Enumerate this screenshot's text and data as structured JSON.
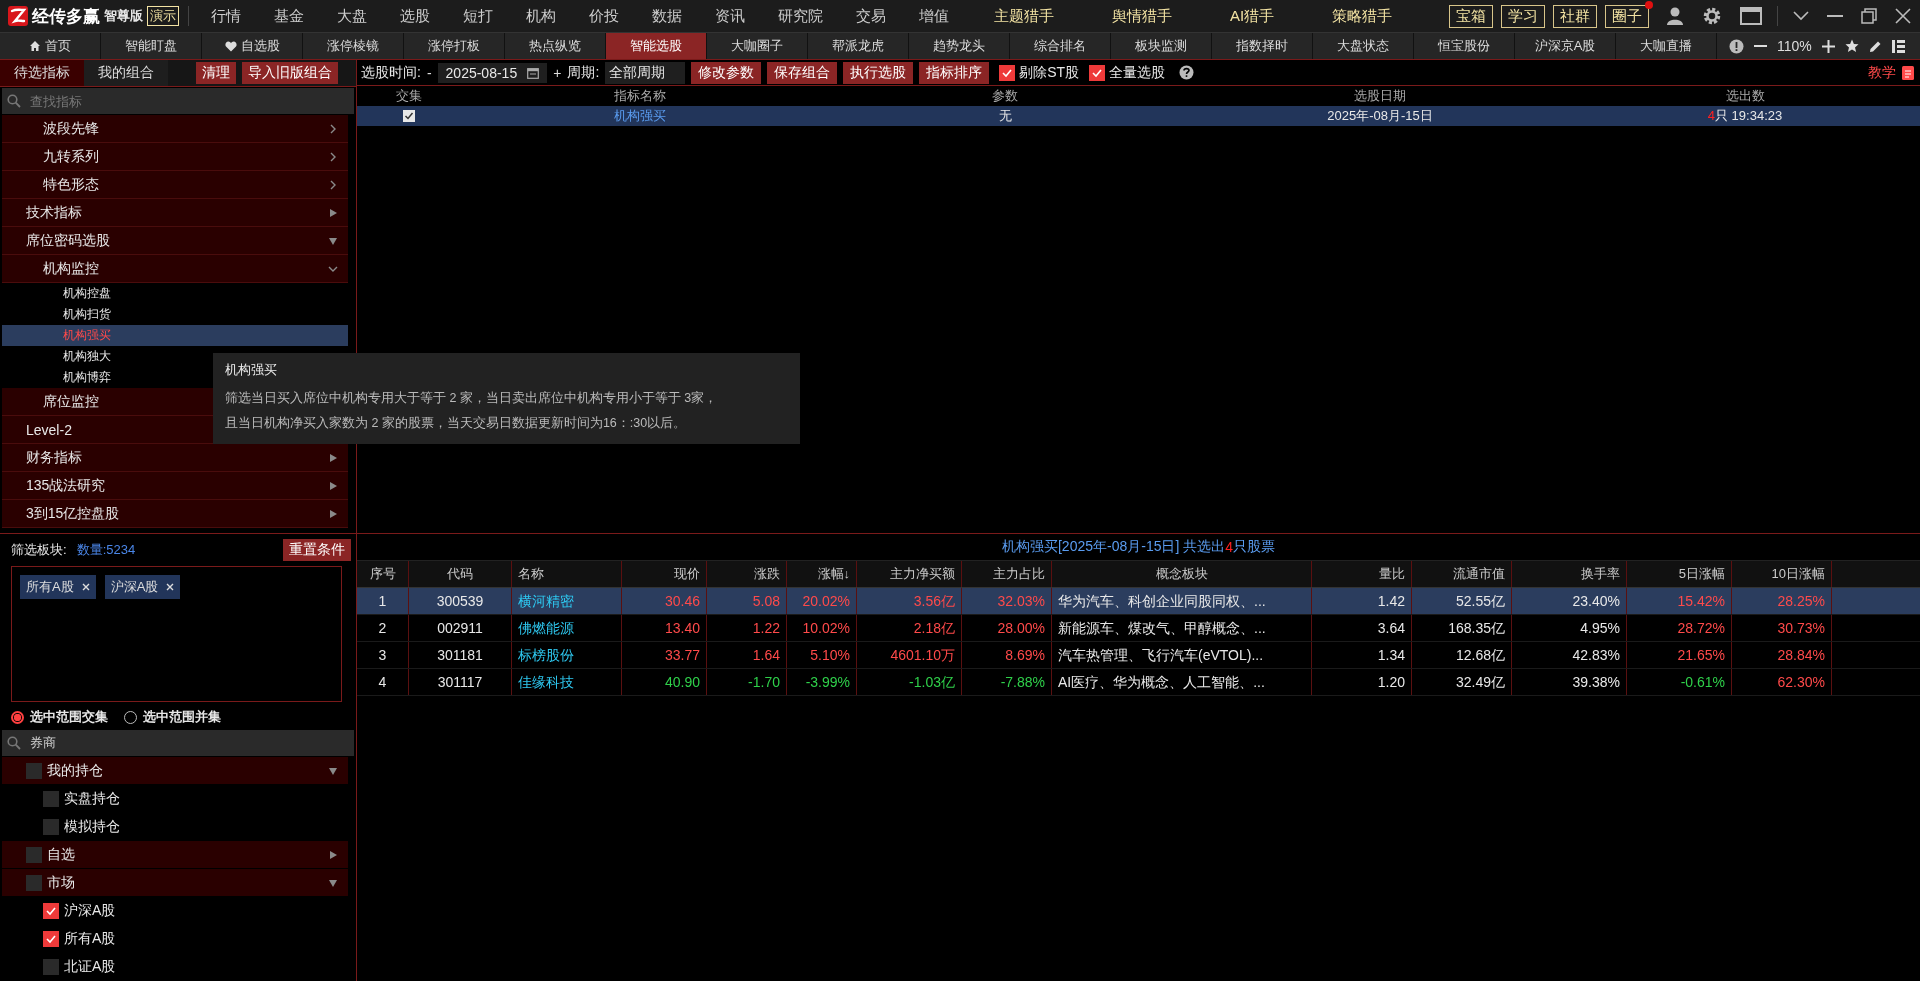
{
  "app": {
    "logo_text": "经传多赢",
    "edition": "智尊版",
    "demo_badge": "演示"
  },
  "main_menu": [
    {
      "label": "行情",
      "highlight": false
    },
    {
      "label": "基金",
      "highlight": false
    },
    {
      "label": "大盘",
      "highlight": false
    },
    {
      "label": "选股",
      "highlight": false
    },
    {
      "label": "短打",
      "highlight": false
    },
    {
      "label": "机构",
      "highlight": false
    },
    {
      "label": "价投",
      "highlight": false
    },
    {
      "label": "数据",
      "highlight": false
    },
    {
      "label": "资讯",
      "highlight": false
    },
    {
      "label": "研究院",
      "highlight": false
    },
    {
      "label": "交易",
      "highlight": false
    },
    {
      "label": "增值",
      "highlight": false
    },
    {
      "label": "主题猎手",
      "highlight": true
    },
    {
      "label": "舆情猎手",
      "highlight": true
    },
    {
      "label": "AI猎手",
      "highlight": true
    },
    {
      "label": "策略猎手",
      "highlight": true
    }
  ],
  "header_buttons": [
    {
      "label": "宝箱",
      "badge": false
    },
    {
      "label": "学习",
      "badge": false
    },
    {
      "label": "社群",
      "badge": false
    },
    {
      "label": "圈子",
      "badge": true
    }
  ],
  "tabs": [
    {
      "label": "首页",
      "kind": "home",
      "selected": false
    },
    {
      "label": "智能盯盘",
      "kind": "plain",
      "selected": false
    },
    {
      "label": "自选股",
      "kind": "favorite",
      "selected": false
    },
    {
      "label": "涨停棱镜",
      "kind": "plain",
      "selected": false
    },
    {
      "label": "涨停打板",
      "kind": "plain",
      "selected": false
    },
    {
      "label": "热点纵览",
      "kind": "plain",
      "selected": false
    },
    {
      "label": "智能选股",
      "kind": "plain",
      "selected": true
    },
    {
      "label": "大咖圈子",
      "kind": "plain",
      "selected": false
    },
    {
      "label": "帮派龙虎",
      "kind": "plain",
      "selected": false
    },
    {
      "label": "趋势龙头",
      "kind": "plain",
      "selected": false
    },
    {
      "label": "综合排名",
      "kind": "plain",
      "selected": false
    },
    {
      "label": "板块监测",
      "kind": "plain",
      "selected": false
    },
    {
      "label": "指数择时",
      "kind": "plain",
      "selected": false
    },
    {
      "label": "大盘状态",
      "kind": "plain",
      "selected": false
    },
    {
      "label": "恒宝股份",
      "kind": "plain",
      "selected": false
    },
    {
      "label": "沪深京A股",
      "kind": "plain",
      "selected": false
    },
    {
      "label": "大咖直播",
      "kind": "plain",
      "selected": false
    }
  ],
  "zoom": "110%",
  "left_tabs": [
    {
      "label": "待选指标",
      "selected": true
    },
    {
      "label": "我的组合",
      "selected": false
    }
  ],
  "left_buttons": [
    "清理",
    "导入旧版组合"
  ],
  "indicator_search": {
    "placeholder": "查找指标"
  },
  "indicator_tree": [
    {
      "children": [
        {
          "label": "波段先锋",
          "kind": "group",
          "expanded": false
        },
        {
          "label": "九转系列",
          "kind": "group",
          "expanded": false
        },
        {
          "label": "特色形态",
          "kind": "group",
          "expanded": false
        }
      ]
    },
    {
      "label": "技术指标",
      "kind": "group",
      "expanded": false
    },
    {
      "label": "席位密码选股",
      "kind": "group",
      "expanded": true,
      "children": [
        {
          "label": "机构监控",
          "kind": "group",
          "expanded": true,
          "children": [
            {
              "label": "机构控盘",
              "kind": "leaf",
              "selected": false
            },
            {
              "label": "机构扫货",
              "kind": "leaf",
              "selected": false
            },
            {
              "label": "机构强买",
              "kind": "leaf",
              "selected": true
            },
            {
              "label": "机构独大",
              "kind": "leaf",
              "selected": false
            },
            {
              "label": "机构博弈",
              "kind": "leaf",
              "selected": false
            }
          ]
        },
        {
          "label": "席位监控",
          "kind": "group"
        }
      ]
    },
    {
      "label": "Level-2",
      "kind": "group"
    },
    {
      "label": "财务指标",
      "kind": "group",
      "expanded": false
    },
    {
      "label": "135战法研究",
      "kind": "group",
      "expanded": false
    },
    {
      "label": "3到15亿控盘股",
      "kind": "group",
      "expanded": false
    }
  ],
  "tooltip": {
    "title": "机构强买",
    "lines": [
      "筛选当日买入席位中机构专用大于等于 2 家，当日卖出席位中机构专用小于等于 3家，",
      "且当日机构净买入家数为 2 家的股票，当天交易日数据更新时间为16：:30以后。"
    ]
  },
  "toolbar": {
    "date_label": "选股时间:",
    "minus": "-",
    "date": "2025-08-15",
    "plus": "+",
    "period_label": "周期:",
    "period": "全部周期",
    "buttons": [
      "修改参数",
      "保存组合",
      "执行选股",
      "指标排序"
    ],
    "options": [
      {
        "label": "剔除ST股",
        "checked": true
      },
      {
        "label": "全量选股",
        "checked": true
      }
    ],
    "tutorial": "教学"
  },
  "criteria_table": {
    "columns": [
      "交集",
      "指标名称",
      "参数",
      "选股日期",
      "选出数"
    ],
    "rows": [
      {
        "intersect": true,
        "name": "机构强买",
        "param": "无",
        "date": "2025年-08月-15日",
        "count": "4",
        "count_suffix": "只 19:34:23",
        "selected": true
      }
    ]
  },
  "filter": {
    "label": "筛选板块:",
    "count": "数量:5234",
    "reset": "重置条件",
    "tags": [
      "所有A股",
      "沪深A股"
    ],
    "modes": [
      {
        "label": "选中范围交集",
        "selected": true
      },
      {
        "label": "选中范围并集",
        "selected": false
      }
    ]
  },
  "sector_search": {
    "value": "券商"
  },
  "sector_tree": [
    {
      "label": "我的持仓",
      "checked": false,
      "expanded": true,
      "children": [
        {
          "label": "实盘持仓",
          "checked": false
        },
        {
          "label": "模拟持仓",
          "checked": false
        }
      ]
    },
    {
      "label": "自选",
      "checked": false,
      "expanded": false
    },
    {
      "label": "市场",
      "checked": false,
      "expanded": true,
      "children": [
        {
          "label": "沪深A股",
          "checked": true
        },
        {
          "label": "所有A股",
          "checked": true
        },
        {
          "label": "北证A股",
          "checked": false
        }
      ]
    }
  ],
  "results": {
    "title": "机构强买[2025年-08月-15日] 共选出",
    "count": "4",
    "title_suffix": "只股票",
    "columns": [
      "序号",
      "代码",
      "名称",
      "现价",
      "涨跌",
      "涨幅↓",
      "主力净买额",
      "主力占比",
      "概念板块",
      "量比",
      "流通市值",
      "换手率",
      "5日涨幅",
      "10日涨幅"
    ],
    "rows": [
      {
        "no": "1",
        "code": "300539",
        "name": "横河精密",
        "price": "30.46",
        "change": "5.08",
        "pct": "20.02%",
        "net_buy": "3.56亿",
        "net_ratio": "32.03%",
        "concept": "华为汽车、科创企业同股同权、...",
        "vol_ratio": "1.42",
        "float_cap": "52.55亿",
        "turnover": "23.40%",
        "chg5": "15.42%",
        "chg10": "28.25%",
        "up": true,
        "up5": true,
        "up10": true,
        "selected": true
      },
      {
        "no": "2",
        "code": "002911",
        "name": "佛燃能源",
        "price": "13.40",
        "change": "1.22",
        "pct": "10.02%",
        "net_buy": "2.18亿",
        "net_ratio": "28.00%",
        "concept": "新能源车、煤改气、甲醇概念、...",
        "vol_ratio": "3.64",
        "float_cap": "168.35亿",
        "turnover": "4.95%",
        "chg5": "28.72%",
        "chg10": "30.73%",
        "up": true,
        "up5": true,
        "up10": true,
        "selected": false
      },
      {
        "no": "3",
        "code": "301181",
        "name": "标榜股份",
        "price": "33.77",
        "change": "1.64",
        "pct": "5.10%",
        "net_buy": "4601.10万",
        "net_ratio": "8.69%",
        "concept": "汽车热管理、飞行汽车(eVTOL)...",
        "vol_ratio": "1.34",
        "float_cap": "12.68亿",
        "turnover": "42.83%",
        "chg5": "21.65%",
        "chg10": "28.84%",
        "up": true,
        "up5": true,
        "up10": true,
        "selected": false
      },
      {
        "no": "4",
        "code": "301117",
        "name": "佳缘科技",
        "price": "40.90",
        "change": "-1.70",
        "pct": "-3.99%",
        "net_buy": "-1.03亿",
        "net_ratio": "-7.88%",
        "concept": "AI医疗、华为概念、人工智能、...",
        "vol_ratio": "1.20",
        "float_cap": "32.49亿",
        "turnover": "39.38%",
        "chg5": "-0.61%",
        "chg10": "62.30%",
        "up": false,
        "up5": false,
        "up10": true,
        "selected": false
      }
    ]
  }
}
